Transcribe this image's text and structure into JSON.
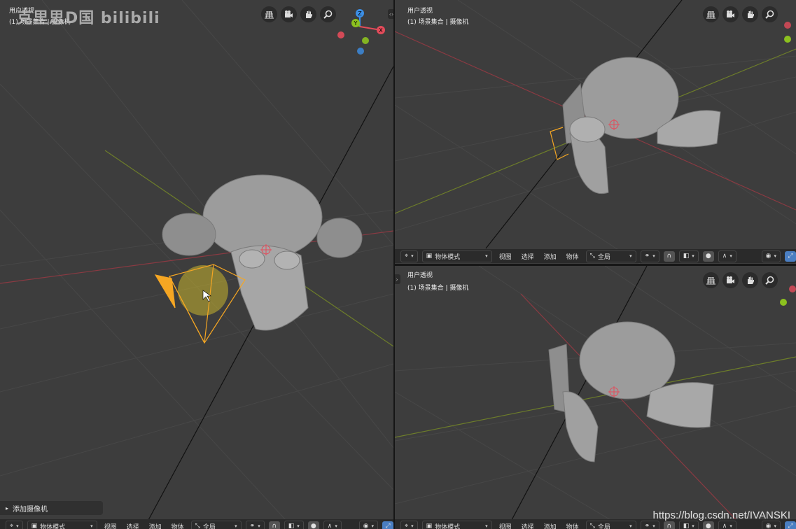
{
  "viewports": {
    "left": {
      "title": "用户透视",
      "subtitle": "(1) 场景集合 | 摄像机",
      "header": {
        "mode": "物体模式",
        "menus": [
          "视图",
          "选择",
          "添加",
          "物体"
        ],
        "transform": "全局"
      },
      "gizmo_axes": {
        "z": "Z",
        "y": "Y",
        "x": "X"
      }
    },
    "top_right": {
      "title": "用户透视",
      "subtitle": "(1) 场景集合 | 摄像机",
      "header": {
        "mode": "物体模式",
        "menus": [
          "视图",
          "选择",
          "添加",
          "物体"
        ],
        "transform": "全局"
      }
    },
    "bottom_right": {
      "title": "用户透视",
      "subtitle": "(1) 场景集合 | 摄像机",
      "header": {
        "mode": "物体模式",
        "menus": [
          "视图",
          "选择",
          "添加",
          "物体"
        ],
        "transform": "全局"
      }
    }
  },
  "nav_icons": [
    "grid-icon",
    "camera-icon",
    "hand-icon",
    "zoom-icon"
  ],
  "operator_panel": {
    "label": "添加摄像机"
  },
  "watermark": "克里思D国 bilibili",
  "csdn_watermark": "https://blog.csdn.net/IVANSKI",
  "colors": {
    "axis_x": "#e34b5a",
    "axis_y": "#8cc11f",
    "axis_z": "#3c8fe6",
    "selection": "#f5a623",
    "grid": "#474747",
    "background": "#3d3d3d"
  }
}
